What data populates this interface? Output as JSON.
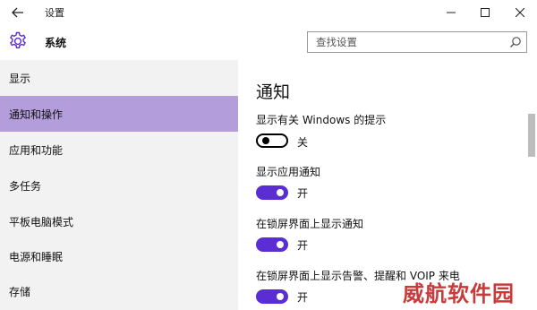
{
  "titlebar": {
    "title": "设置"
  },
  "header": {
    "title": "系统"
  },
  "search": {
    "placeholder": "查找设置"
  },
  "sidebar": {
    "items": [
      {
        "label": "显示",
        "active": false
      },
      {
        "label": "通知和操作",
        "active": true
      },
      {
        "label": "应用和功能",
        "active": false
      },
      {
        "label": "多任务",
        "active": false
      },
      {
        "label": "平板电脑模式",
        "active": false
      },
      {
        "label": "电源和睡眠",
        "active": false
      },
      {
        "label": "存储",
        "active": false
      }
    ]
  },
  "main": {
    "section_title": "通知",
    "settings": [
      {
        "label": "显示有关 Windows 的提示",
        "state": "关",
        "on": false
      },
      {
        "label": "显示应用通知",
        "state": "开",
        "on": true
      },
      {
        "label": "在锁屏界面上显示通知",
        "state": "开",
        "on": true
      },
      {
        "label": "在锁屏界面上显示告警、提醒和 VOIP 来电",
        "state": "开",
        "on": true
      }
    ]
  },
  "colors": {
    "accent": "#5b2ed3",
    "selected_nav": "#b39ddb",
    "sidebar_bg": "#f2f2f2"
  },
  "watermark": "威航软件园",
  "icons": [
    "back-arrow-icon",
    "minimize-icon",
    "maximize-icon",
    "close-icon",
    "gear-icon",
    "search-icon"
  ]
}
